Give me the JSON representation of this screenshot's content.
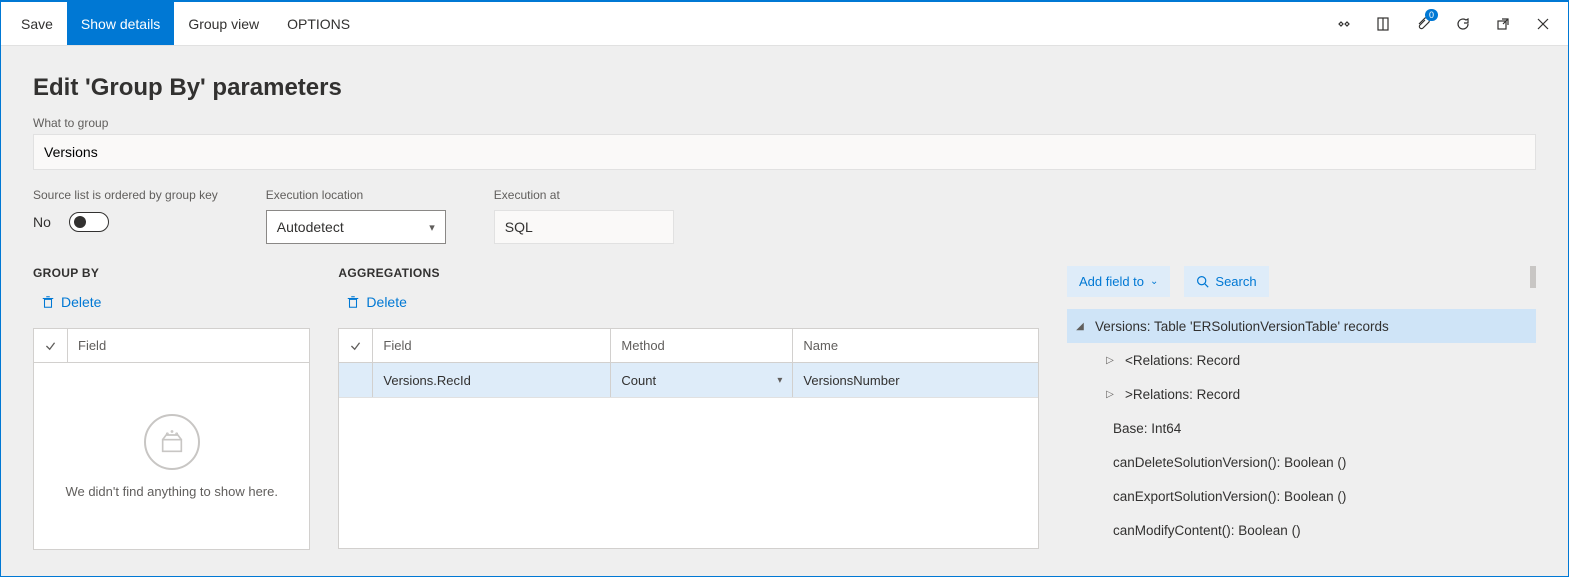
{
  "toolbar": {
    "save_label": "Save",
    "show_details_label": "Show details",
    "group_view_label": "Group view",
    "options_label": "OPTIONS",
    "badge_count": "0"
  },
  "page": {
    "title": "Edit 'Group By' parameters",
    "what_to_group_label": "What to group",
    "what_to_group_value": "Versions",
    "ordered_label": "Source list is ordered by group key",
    "ordered_value": "No",
    "exec_location_label": "Execution location",
    "exec_location_value": "Autodetect",
    "exec_at_label": "Execution at",
    "exec_at_value": "SQL"
  },
  "groupby": {
    "header": "GROUP BY",
    "delete_label": "Delete",
    "column_field": "Field",
    "empty_text": "We didn't find anything to show here."
  },
  "agg": {
    "header": "AGGREGATIONS",
    "delete_label": "Delete",
    "columns": {
      "field": "Field",
      "method": "Method",
      "name": "Name"
    },
    "rows": [
      {
        "field": "Versions.RecId",
        "method": "Count",
        "name": "VersionsNumber"
      }
    ]
  },
  "right": {
    "add_field_label": "Add field to",
    "search_label": "Search",
    "tree": {
      "root": "Versions: Table 'ERSolutionVersionTable' records",
      "children": [
        {
          "expander": "▷",
          "label": "<Relations: Record"
        },
        {
          "expander": "▷",
          "label": ">Relations: Record"
        },
        {
          "expander": "",
          "label": "Base: Int64"
        },
        {
          "expander": "",
          "label": "canDeleteSolutionVersion(): Boolean ()"
        },
        {
          "expander": "",
          "label": "canExportSolutionVersion(): Boolean ()"
        },
        {
          "expander": "",
          "label": "canModifyContent(): Boolean ()"
        }
      ]
    }
  }
}
